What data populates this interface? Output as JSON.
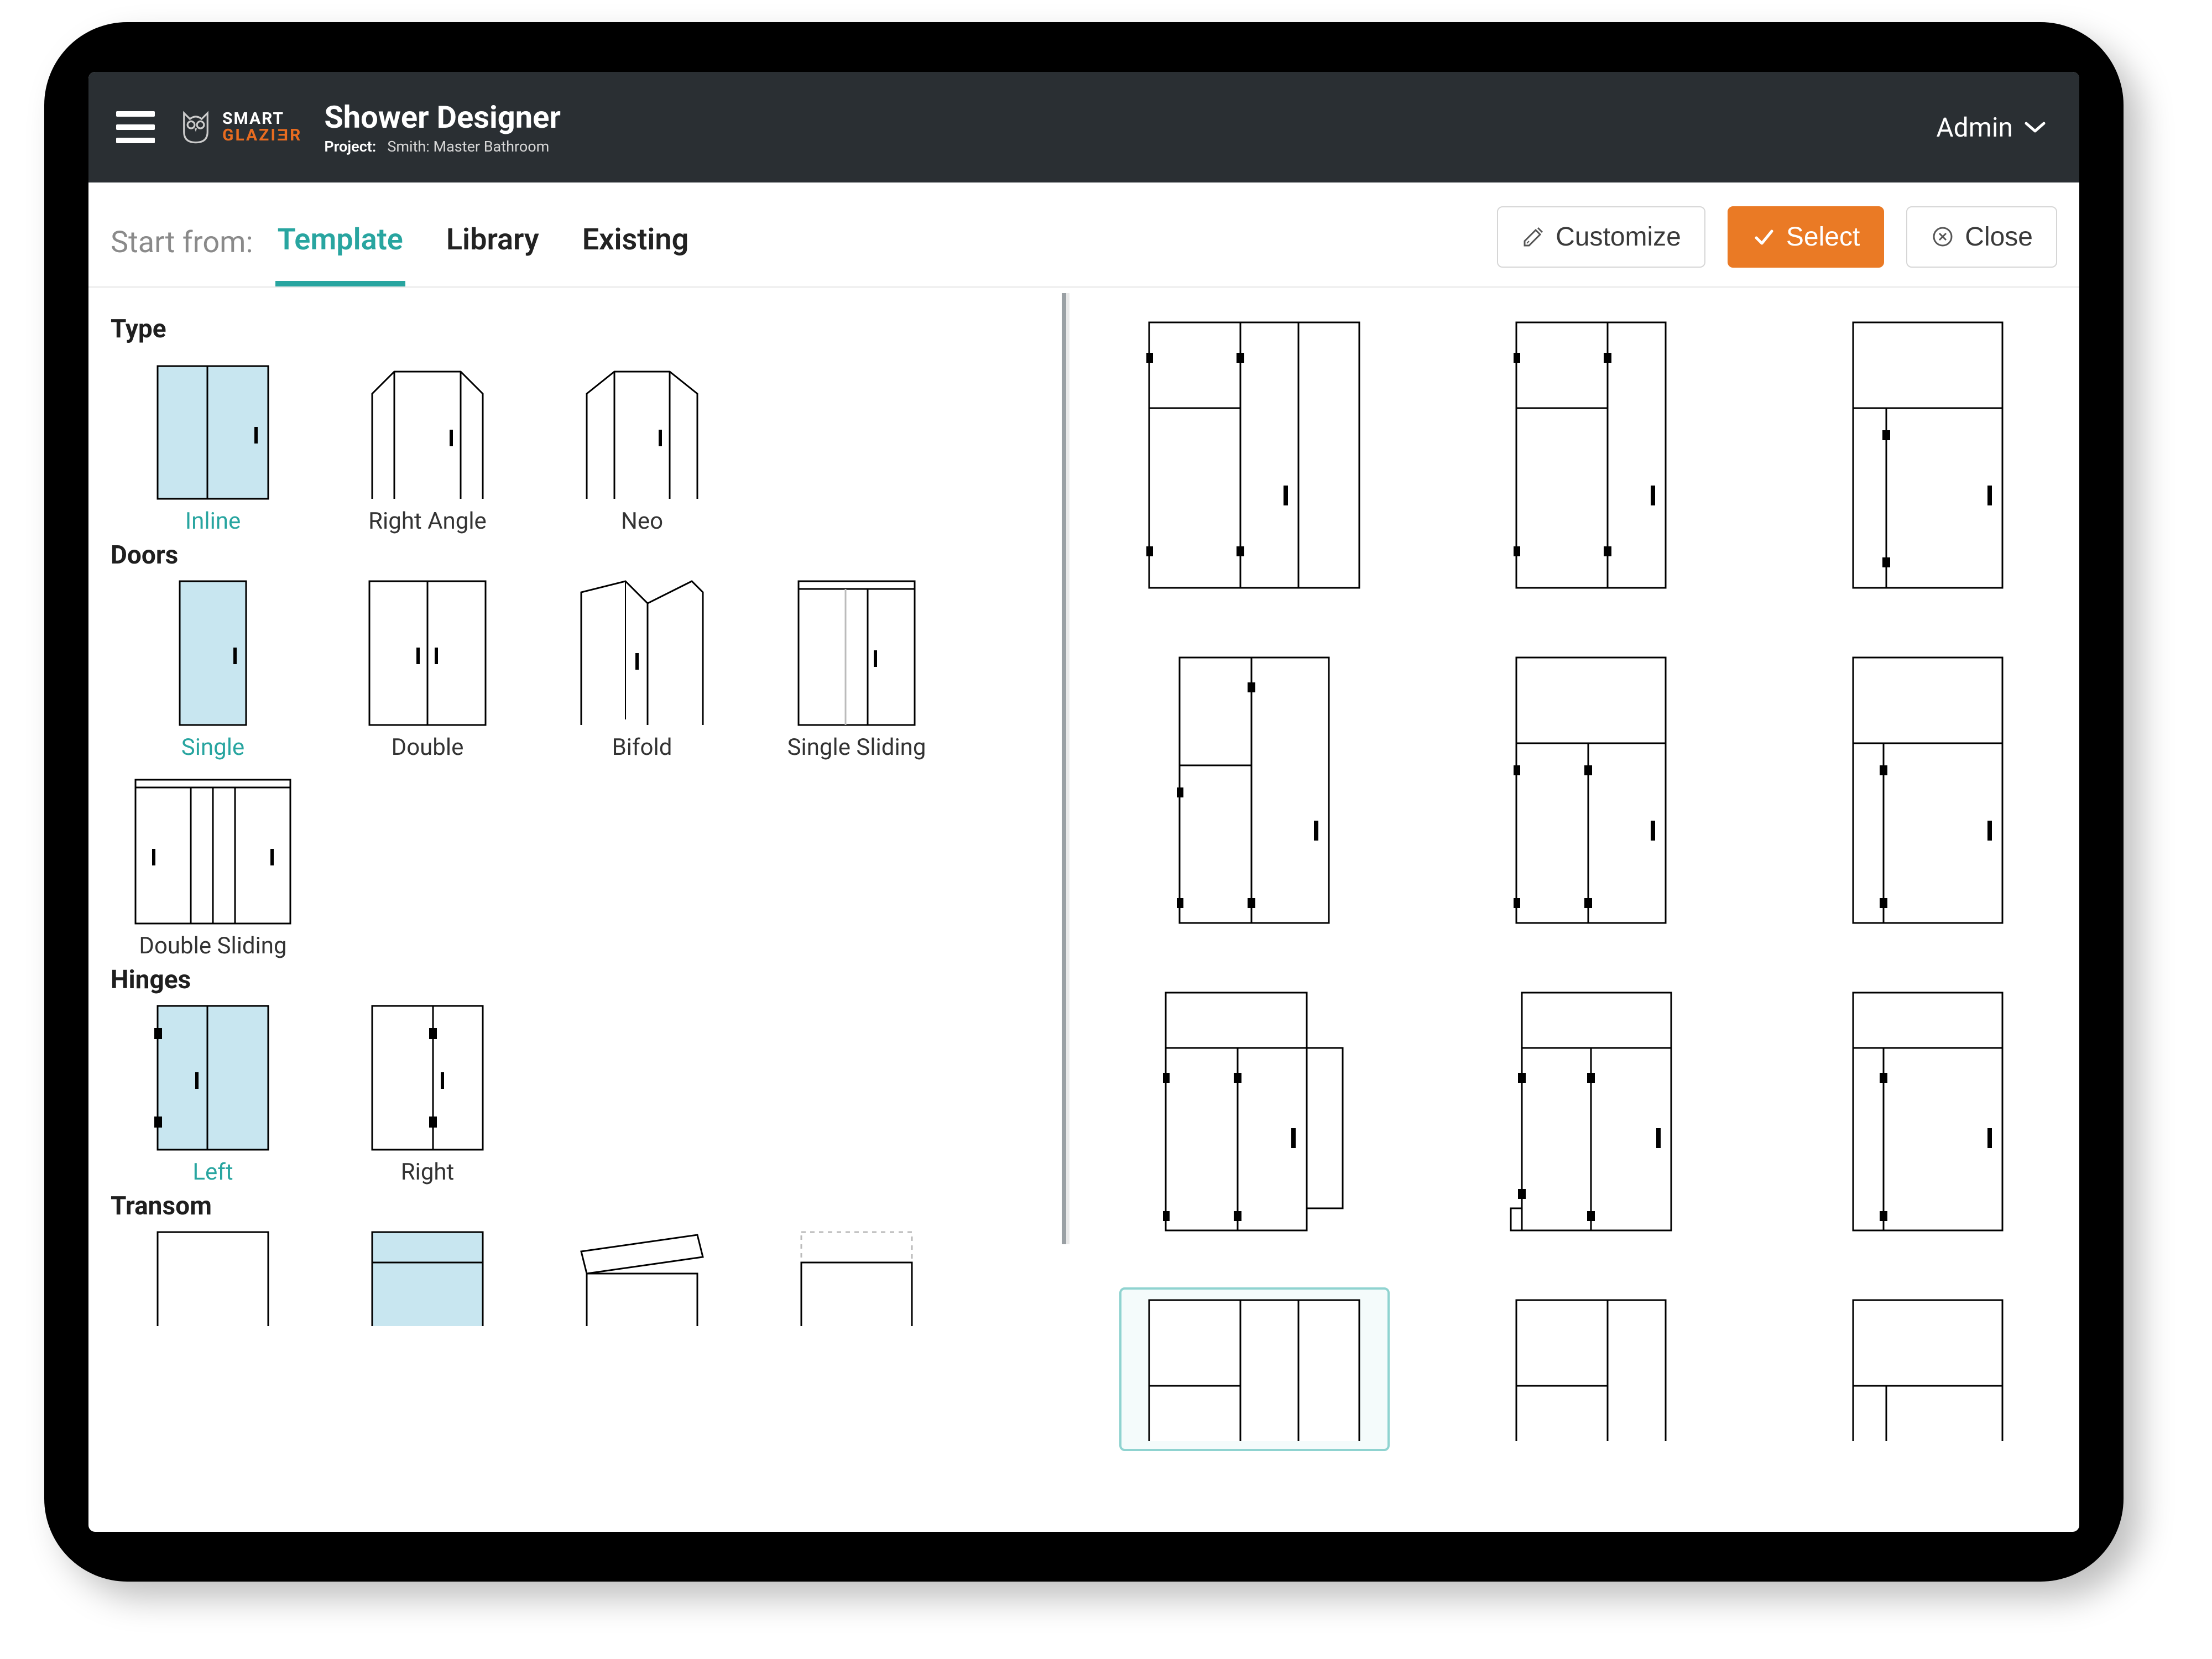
{
  "header": {
    "brand_top": "SMART",
    "brand_bot": "GLAZIƎR",
    "page_title": "Shower Designer",
    "project_label": "Project:",
    "project_name": "Smith: Master Bathroom",
    "admin_label": "Admin"
  },
  "toolbar": {
    "start_label": "Start from:",
    "tabs": {
      "template": "Template",
      "library": "Library",
      "existing": "Existing"
    },
    "customize": "Customize",
    "select": "Select",
    "close": "Close"
  },
  "groups": {
    "type": {
      "heading": "Type",
      "options": {
        "inline": "Inline",
        "right_angle": "Right Angle",
        "neo": "Neo"
      }
    },
    "doors": {
      "heading": "Doors",
      "options": {
        "single": "Single",
        "double": "Double",
        "bifold": "Bifold",
        "single_sliding": "Single Sliding",
        "double_sliding": "Double Sliding"
      }
    },
    "hinges": {
      "heading": "Hinges",
      "options": {
        "left": "Left",
        "right": "Right"
      }
    },
    "transom": {
      "heading": "Transom"
    }
  },
  "colors": {
    "accent_teal": "#28a5a0",
    "accent_orange": "#ea7a25",
    "selected_fill": "#c8e6f0"
  }
}
